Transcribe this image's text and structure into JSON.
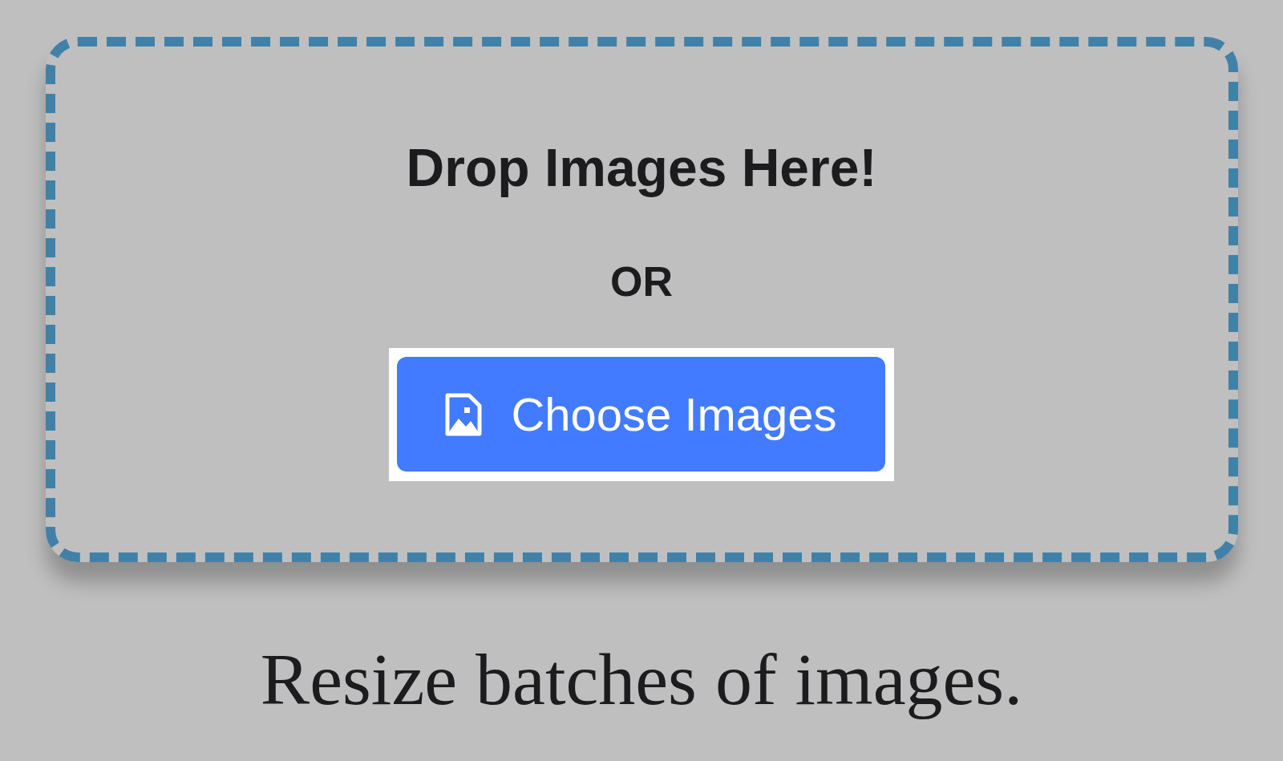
{
  "drop_zone": {
    "title": "Drop Images Here!",
    "separator": "OR",
    "button": {
      "label": "Choose Images"
    }
  },
  "tagline": "Resize batches of images."
}
